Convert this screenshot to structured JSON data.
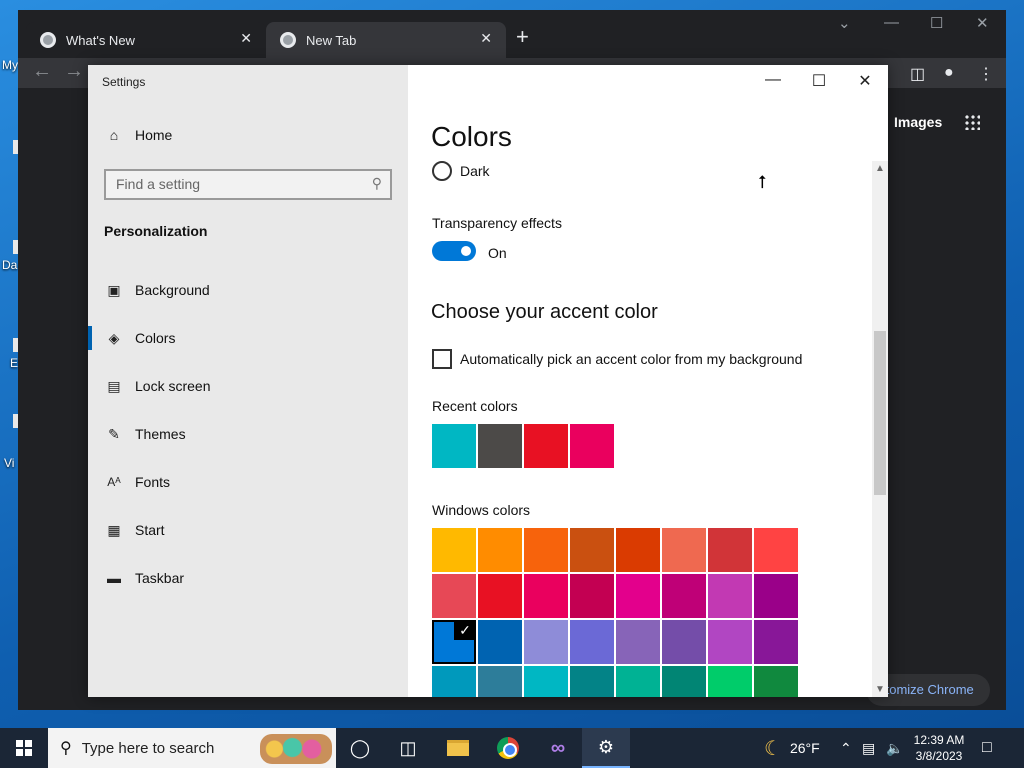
{
  "desktop": {
    "icon_labels": [
      "My",
      "Da",
      "E",
      "Vi"
    ]
  },
  "chrome": {
    "tabs": [
      {
        "label": "What's New"
      },
      {
        "label": "New Tab"
      }
    ],
    "new_tab": "+",
    "close_tab": "✕",
    "images_link": "Images",
    "customize_label": "ıtomize Chrome"
  },
  "settings": {
    "app_title": "Settings",
    "home_label": "Home",
    "search_placeholder": "Find a setting",
    "section_heading": "Personalization",
    "nav_items": [
      {
        "label": "Background",
        "icon": "picture-icon"
      },
      {
        "label": "Colors",
        "icon": "palette-icon"
      },
      {
        "label": "Lock screen",
        "icon": "lock-screen-icon"
      },
      {
        "label": "Themes",
        "icon": "themes-icon"
      },
      {
        "label": "Fonts",
        "icon": "fonts-icon"
      },
      {
        "label": "Start",
        "icon": "start-icon"
      },
      {
        "label": "Taskbar",
        "icon": "taskbar-icon"
      }
    ],
    "active_nav": "Colors",
    "page_title": "Colors",
    "dark_option": "Dark",
    "transparency_label": "Transparency effects",
    "transparency_state": "On",
    "accent_heading": "Choose your accent color",
    "auto_accent_label": "Automatically pick an accent color from my background",
    "recent_colors_label": "Recent colors",
    "recent_colors": [
      "#00b7c3",
      "#4c4a48",
      "#e81123",
      "#ea005e"
    ],
    "windows_colors_label": "Windows colors",
    "windows_colors": [
      "#ffb900",
      "#ff8c00",
      "#f7630c",
      "#ca5010",
      "#da3b01",
      "#ef6950",
      "#d13438",
      "#ff4343",
      "#e74856",
      "#e81123",
      "#ea005e",
      "#c30052",
      "#e3008c",
      "#bf0077",
      "#c239b3",
      "#9a0089",
      "#0078d7",
      "#0063b1",
      "#8e8cd8",
      "#6b69d6",
      "#8764b8",
      "#744da9",
      "#b146c2",
      "#881798",
      "#0099bc",
      "#2d7d9a",
      "#00b7c3",
      "#038387",
      "#00b294",
      "#018574",
      "#00cc6a",
      "#10893e"
    ],
    "selected_color_index": 16
  },
  "taskbar": {
    "search_placeholder": "Type here to search",
    "weather": "26°F",
    "time": "12:39 AM",
    "date": "3/8/2023"
  }
}
